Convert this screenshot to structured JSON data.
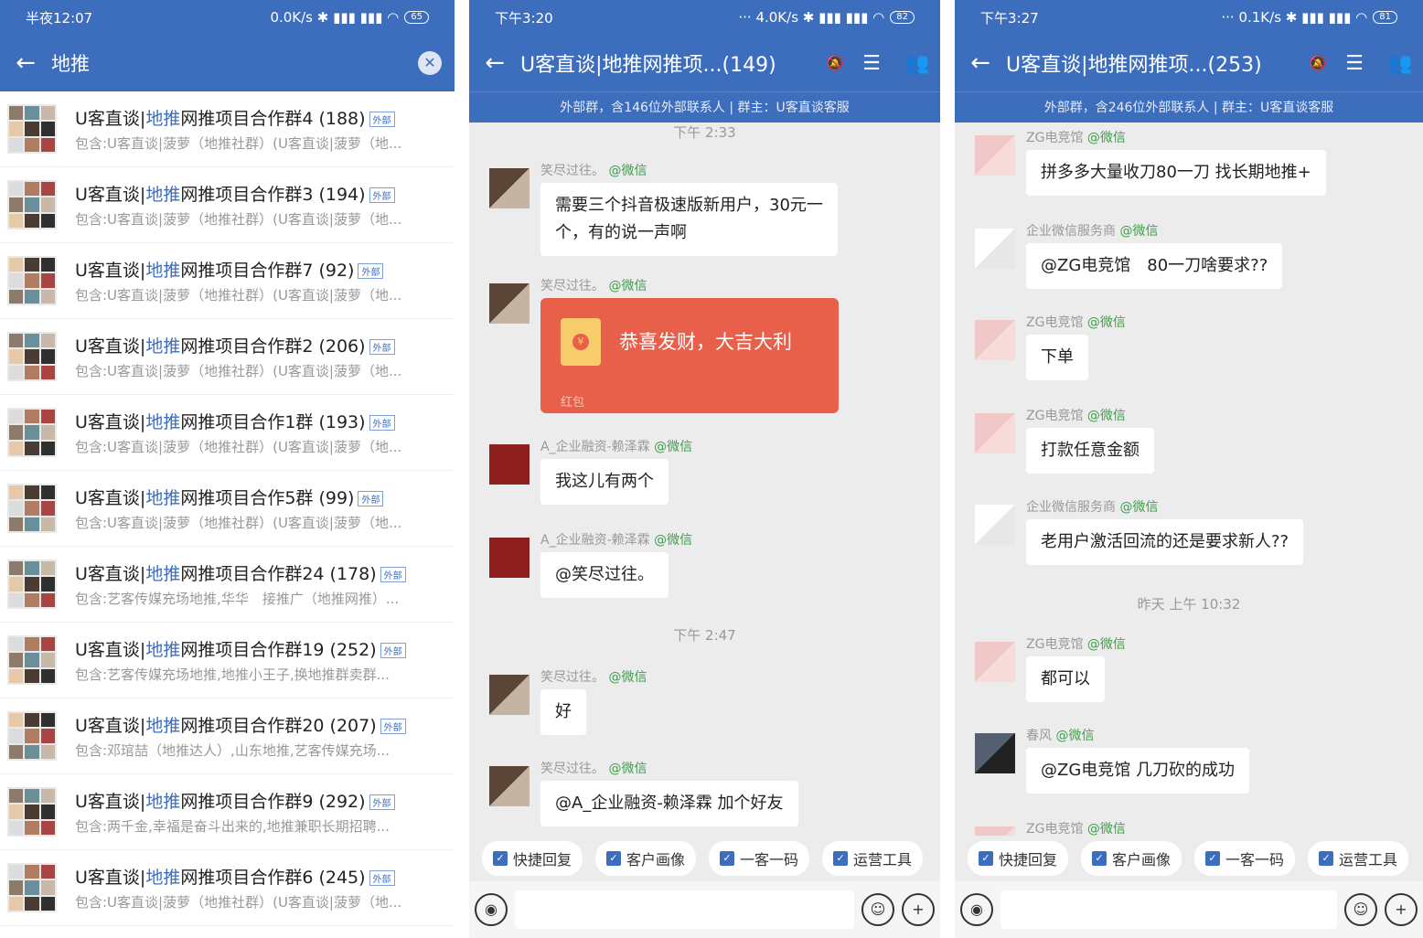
{
  "search_screen": {
    "status_time": "半夜12:07",
    "status_right": "0.0K/s ✱ ▮▮▮ ▮▮▮ ◠",
    "battery": "65",
    "back_icon": "arrow-left-icon",
    "query": "地推",
    "clear_icon": "clear-icon",
    "tag": "外部",
    "groups": [
      {
        "pre": "U客直谈|",
        "hl": "地推",
        "post": "网推项目合作群4 (188)",
        "desc": "包含:U客直谈|菠萝（地推社群）(U客直谈|菠萝（地..."
      },
      {
        "pre": "U客直谈|",
        "hl": "地推",
        "post": "网推项目合作群3 (194)",
        "desc": "包含:U客直谈|菠萝（地推社群）(U客直谈|菠萝（地..."
      },
      {
        "pre": "U客直谈|",
        "hl": "地推",
        "post": "网推项目合作群7 (92)",
        "desc": "包含:U客直谈|菠萝（地推社群）(U客直谈|菠萝（地..."
      },
      {
        "pre": "U客直谈|",
        "hl": "地推",
        "post": "网推项目合作群2 (206)",
        "desc": "包含:U客直谈|菠萝（地推社群）(U客直谈|菠萝（地..."
      },
      {
        "pre": "U客直谈|",
        "hl": "地推",
        "post": "网推项目合作1群 (193)",
        "desc": "包含:U客直谈|菠萝（地推社群）(U客直谈|菠萝（地..."
      },
      {
        "pre": "U客直谈|",
        "hl": "地推",
        "post": "网推项目合作5群 (99)",
        "desc": "包含:U客直谈|菠萝（地推社群）(U客直谈|菠萝（地..."
      },
      {
        "pre": "U客直谈|",
        "hl": "地推",
        "post": "网推项目合作群24 (178)",
        "desc": "包含:艺客传媒充场地推,华华　接推广（地推网推）..."
      },
      {
        "pre": "U客直谈|",
        "hl": "地推",
        "post": "网推项目合作群19 (252)",
        "desc": "包含:艺客传媒充场地推,地推小王子,换地推群卖群..."
      },
      {
        "pre": "U客直谈|",
        "hl": "地推",
        "post": "网推项目合作群20 (207)",
        "desc": "包含:邓琯喆（地推达人）,山东地推,艺客传媒充场..."
      },
      {
        "pre": "U客直谈|",
        "hl": "地推",
        "post": "网推项目合作群9 (292)",
        "desc": "包含:两千金,幸福是奋斗出来的,地推兼职长期招聘..."
      },
      {
        "pre": "U客直谈|",
        "hl": "地推",
        "post": "网推项目合作群6 (245)",
        "desc": "包含:U客直谈|菠萝（地推社群）(U客直谈|菠萝（地..."
      }
    ]
  },
  "chat1": {
    "status_time": "下午3:20",
    "status_right": "··· 4.0K/s ✱ ▮▮▮ ▮▮▮ ◠",
    "battery": "82",
    "title": "U客直谈|地推网推项...(149)",
    "subtitle": "外部群，含146位外部联系人 | 群主：U客直谈客服",
    "wx_tag": "@微信",
    "items": [
      {
        "kind": "time",
        "text": "下午 2:33"
      },
      {
        "kind": "msg",
        "name": "笑尽过往。",
        "text": "需要三个抖音极速版新用户，30元一\n个，有的说一声啊"
      },
      {
        "kind": "hongbao",
        "name": "笑尽过往。",
        "text": "恭喜发财，大吉大利",
        "sub": "红包"
      },
      {
        "kind": "msg",
        "name": "A_企业融资-赖泽霖",
        "text": "我这儿有两个"
      },
      {
        "kind": "msg",
        "name": "A_企业融资-赖泽霖",
        "text": "@笑尽过往。"
      },
      {
        "kind": "time",
        "text": "下午 2:47"
      },
      {
        "kind": "msg",
        "name": "笑尽过往。",
        "text": "好"
      },
      {
        "kind": "msg",
        "name": "笑尽过往。",
        "text": "@A_企业融资-赖泽霖 加个好友"
      }
    ]
  },
  "chat2": {
    "status_time": "下午3:27",
    "status_right": "··· 0.1K/s ✱ ▮▮▮ ▮▮▮ ◠",
    "battery": "81",
    "title": "U客直谈|地推网推项...(253)",
    "subtitle": "外部群，含246位外部联系人 | 群主：U客直谈客服",
    "wx_tag": "@微信",
    "items": [
      {
        "kind": "msg",
        "name": "ZG电竞馆",
        "text": "拼多多大量收刀80一刀 找长期地推+"
      },
      {
        "kind": "msg",
        "name": "企业微信服务商",
        "text": "@ZG电竞馆　80一刀啥要求??"
      },
      {
        "kind": "msg",
        "name": "ZG电竞馆",
        "text": "下单"
      },
      {
        "kind": "msg",
        "name": "ZG电竞馆",
        "text": "打款任意金额"
      },
      {
        "kind": "msg",
        "name": "企业微信服务商",
        "text": "老用户激活回流的还是要求新人??"
      },
      {
        "kind": "time",
        "text": "昨天  上午 10:32"
      },
      {
        "kind": "msg",
        "name": "ZG电竞馆",
        "text": "都可以"
      },
      {
        "kind": "msg",
        "name": "春风",
        "text": "@ZG电竞馆 几刀砍的成功"
      },
      {
        "kind": "msg",
        "name": "ZG电竞馆",
        "text": ""
      }
    ]
  },
  "quick_actions": [
    "快捷回复",
    "客户画像",
    "一客一码",
    "运营工具"
  ],
  "icons": {
    "back": "arrow-left-icon",
    "mute": "mute-icon",
    "menu": "menu-list-icon",
    "members": "group-members-icon",
    "voice": "voice-icon",
    "emoji": "emoji-icon",
    "plus": "plus-icon",
    "check": "checkbox-icon"
  },
  "colors": {
    "header": "#3d6dbd",
    "highlight": "#3d6dbd",
    "wechat_green": "#3ea04a",
    "hongbao": "#e8604a",
    "chat_bg": "#ececec"
  }
}
